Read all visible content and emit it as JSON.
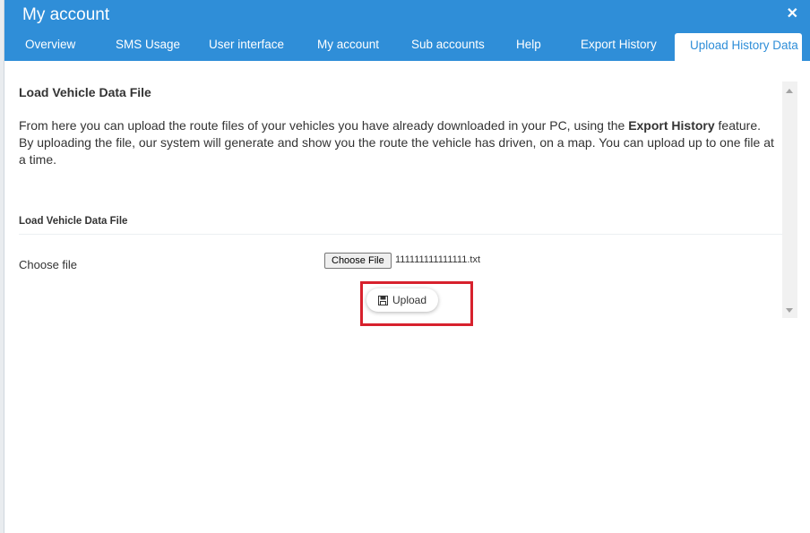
{
  "window": {
    "title": "My account",
    "close_icon": "close-icon"
  },
  "tabs": [
    {
      "label": "Overview"
    },
    {
      "label": "SMS Usage"
    },
    {
      "label": "User interface"
    },
    {
      "label": "My account"
    },
    {
      "label": "Sub accounts"
    },
    {
      "label": "Help"
    },
    {
      "label": "Export History"
    },
    {
      "label": "Upload History Data",
      "active": true
    }
  ],
  "content": {
    "section_title": "Load Vehicle Data File",
    "desc_line1_prefix": "From here you can upload the route files of your vehicles you have already downloaded in your PC, using the ",
    "desc_line1_bold": "Export History",
    "desc_line1_suffix": " feature.",
    "desc_line2": "By uploading the file, our system will generate and show you the route the vehicle has driven, on a map. You can upload up to one file at a time.",
    "subheader": "Load Vehicle Data File",
    "choose_label": "Choose file",
    "file_button": "Choose File",
    "file_name": "111111111111111.txt",
    "upload_label": "Upload",
    "upload_icon": "save-icon"
  },
  "colors": {
    "header": "#2f8ed8",
    "highlight": "#d7212d"
  }
}
